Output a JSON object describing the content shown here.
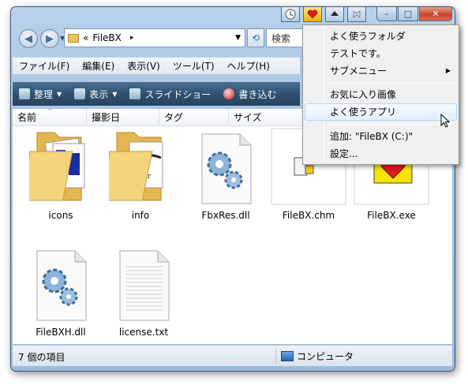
{
  "window": {
    "caption_buttons": {
      "minimize": "–",
      "maximize": "□",
      "close": "✕"
    },
    "ext_buttons": [
      "clock-icon",
      "filebx-heart-icon",
      "eject-icon",
      "pin-icon"
    ]
  },
  "address": {
    "prefix": "«",
    "path": "FileBX",
    "chevron": "▸",
    "search_placeholder": "検索"
  },
  "menubar": [
    "ファイル(F)",
    "編集(E)",
    "表示(V)",
    "ツール(T)",
    "ヘルプ(H)"
  ],
  "toolbar": {
    "organize": "整理",
    "view": "表示",
    "slideshow": "スライドショー",
    "burn": "書き込む"
  },
  "columns": [
    "名前",
    "撮影日",
    "タグ",
    "サイズ"
  ],
  "files": [
    {
      "name": "icons",
      "type": "folder"
    },
    {
      "name": "info",
      "type": "folder"
    },
    {
      "name": "FbxRes.dll",
      "type": "dll"
    },
    {
      "name": "FileBX.chm",
      "type": "chm"
    },
    {
      "name": "FileBX.exe",
      "type": "exe"
    },
    {
      "name": "FileBXH.dll",
      "type": "dll"
    },
    {
      "name": "license.txt",
      "type": "txt"
    }
  ],
  "status": {
    "count": "7 個の項目",
    "location": "コンピュータ"
  },
  "popup_menu": {
    "items": [
      {
        "label": "よく使うフォルダ",
        "submenu": false
      },
      {
        "label": "テストです。",
        "submenu": false
      },
      {
        "label": "サブメニュー",
        "submenu": true
      },
      {
        "label": "お気に入り画像",
        "submenu": false
      },
      {
        "label": "よく使うアプリ",
        "submenu": false,
        "highlighted": true
      },
      {
        "label": "追加: \"FileBX  (C:)\"",
        "submenu": false
      },
      {
        "label": "設定...",
        "submenu": false
      }
    ]
  },
  "colors": {
    "toolbar_bg": "#2f5070",
    "highlight_border": "#a8d8f7",
    "folder_yellow": "#e9c35d"
  }
}
